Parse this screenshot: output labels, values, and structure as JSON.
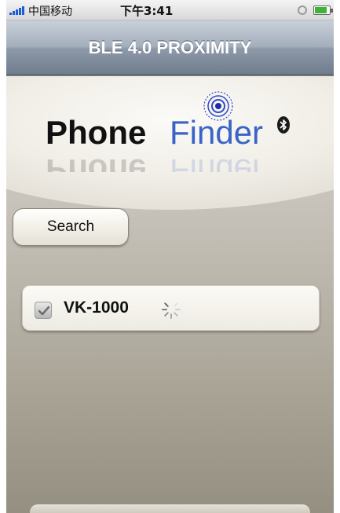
{
  "status_bar": {
    "carrier": "中国移动",
    "time": "下午3:41",
    "icons": [
      "signal-icon",
      "lock-rotation-icon",
      "battery-icon"
    ],
    "battery_level": 0.85,
    "colors": {
      "signal": "#1a5fd6",
      "battery": "#3fb334"
    }
  },
  "nav": {
    "title": "BLE 4.0 PROXIMITY"
  },
  "logo": {
    "part1": "Phone",
    "part2": "Finder",
    "icons": [
      "radar-icon",
      "bluetooth-icon"
    ],
    "colors": {
      "part1": "#111111",
      "part2": "#3a63c7"
    }
  },
  "search_button": {
    "label": "Search"
  },
  "devices": [
    {
      "name": "VK-1000",
      "checked": true,
      "status_icon": "loading-spinner-icon"
    }
  ]
}
